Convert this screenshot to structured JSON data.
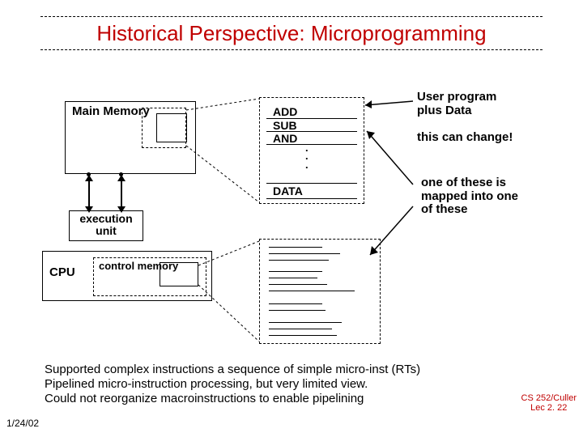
{
  "title": "Historical Perspective: Microprogramming",
  "main_memory": "Main Memory",
  "exec_unit": "execution unit",
  "cpu": "CPU",
  "ctrl_mem": "control memory",
  "instrs": {
    "l1": "ADD",
    "l2": "SUB",
    "l3": "AND",
    "data": "DATA"
  },
  "annot1a": "User program",
  "annot1b": "plus Data",
  "annot2": "this can change!",
  "annot3a": "one of these is",
  "annot3b": "mapped into one",
  "annot3c": "of these",
  "caption1": "Supported complex instructions a sequence of simple micro-inst (RTs)",
  "caption2": "Pipelined micro-instruction processing, but very limited view.",
  "caption3": "Could not reorganize macroinstructions to enable pipelining",
  "date": "1/24/02",
  "lec1": "CS 252/Culler",
  "lec2": "Lec 2. 22"
}
